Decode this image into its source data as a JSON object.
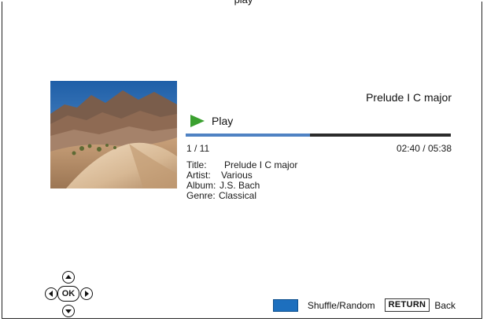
{
  "header": {
    "title_fragment": "play"
  },
  "now_playing": {
    "track_title": "Prelude I C major",
    "status": "Play",
    "status_icon": "play-icon",
    "progress": 0.47,
    "track_index": "1 / 11",
    "time": "02:40 / 05:38"
  },
  "meta": {
    "title_label": "Title:",
    "title_value": "Prelude I C major",
    "artist_label": "Artist:",
    "artist_value": "Various",
    "album_label": "Album:",
    "album_value": "J.S. Bach",
    "genre_label": "Genre:",
    "genre_value": "Classical"
  },
  "dpad": {
    "ok_label": "OK"
  },
  "footer": {
    "shuffle_label": "Shuffle/Random",
    "return_key_label": "RETURN",
    "back_label": "Back"
  },
  "colors": {
    "progress_fill": "#4f82c3",
    "progress_track": "#2b2b2b",
    "play_icon": "#3aa02f",
    "blue_key": "#1d6fbe"
  }
}
